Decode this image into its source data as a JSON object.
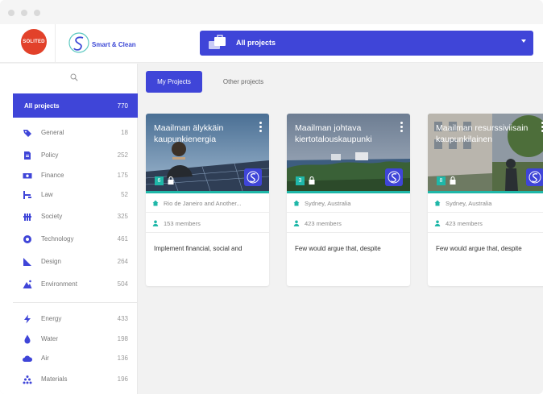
{
  "header": {
    "logo_text": "SOLITED",
    "app_name": "Smart & Clean",
    "project_select": {
      "label": "All projects"
    }
  },
  "sidebar": {
    "all_projects": {
      "label": "All projects",
      "count": "770"
    },
    "categories": [
      {
        "label": "General",
        "count": "18",
        "icon": "tag-icon"
      },
      {
        "label": "Policy",
        "count": "252",
        "icon": "document-icon"
      },
      {
        "label": "Finance",
        "count": "175",
        "icon": "money-icon"
      },
      {
        "label": "Law",
        "count": "52",
        "icon": "gavel-icon"
      },
      {
        "label": "Society",
        "count": "325",
        "icon": "people-icon"
      },
      {
        "label": "Technology",
        "count": "461",
        "icon": "chip-icon"
      },
      {
        "label": "Design",
        "count": "264",
        "icon": "ruler-icon"
      },
      {
        "label": "Environment",
        "count": "504",
        "icon": "mountain-icon"
      },
      {
        "label": "Energy",
        "count": "433",
        "icon": "bolt-icon"
      },
      {
        "label": "Water",
        "count": "198",
        "icon": "drop-icon"
      },
      {
        "label": "Air",
        "count": "136",
        "icon": "cloud-icon"
      },
      {
        "label": "Materials",
        "count": "196",
        "icon": "materials-icon"
      }
    ]
  },
  "tabs": {
    "active": "My Projects",
    "other": "Other projects"
  },
  "cards": [
    {
      "title": "Maailman älykkäin kaupunkienergia",
      "badge": "6",
      "location": "Rio de Janeiro and Another...",
      "members": "153 members",
      "description": "Implement financial, social and"
    },
    {
      "title": "Maailman johtava kiertotalouskaupunki",
      "badge": "3",
      "location": "Sydney, Australia",
      "members": "423 members",
      "description": "Few would argue that, despite"
    },
    {
      "title": "Maailman resurssiviisain kaupunkilainen",
      "badge": "8",
      "location": "Sydney, Australia",
      "members": "423 members",
      "description": "Few would argue that, despite"
    }
  ],
  "colors": {
    "accent": "#3f45d8",
    "teal": "#1fb7a8",
    "brand_red": "#e2412a"
  }
}
